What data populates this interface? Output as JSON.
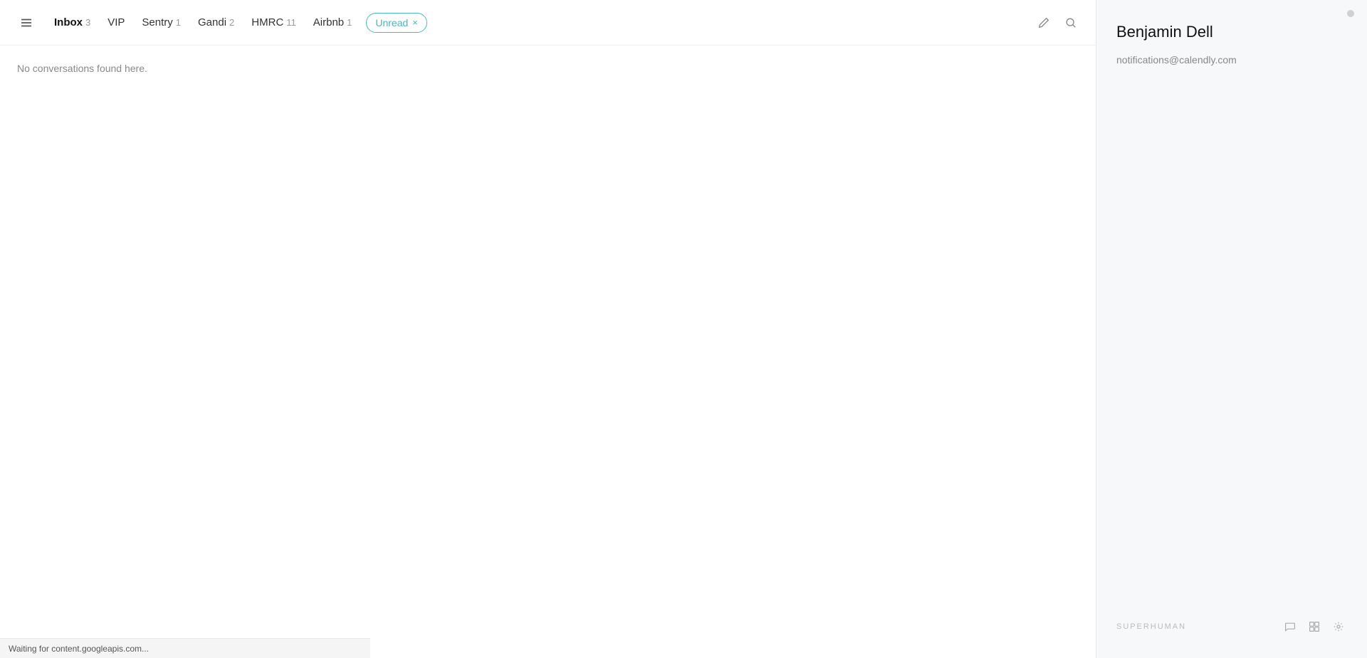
{
  "tabs": [
    {
      "id": "inbox",
      "label": "Inbox",
      "count": "3",
      "active": true
    },
    {
      "id": "vip",
      "label": "VIP",
      "count": null,
      "active": false
    },
    {
      "id": "sentry",
      "label": "Sentry",
      "count": "1",
      "active": false
    },
    {
      "id": "gandi",
      "label": "Gandi",
      "count": "2",
      "active": false
    },
    {
      "id": "hmrc",
      "label": "HMRC",
      "count": "11",
      "active": false
    },
    {
      "id": "airbnb",
      "label": "Airbnb",
      "count": "1",
      "active": false
    }
  ],
  "filter": {
    "label": "Unread",
    "close_label": "×"
  },
  "empty_state": {
    "text": "No conversations found here."
  },
  "contact": {
    "name": "Benjamin Dell",
    "email": "notifications@calendly.com"
  },
  "brand": {
    "logo": "SUPERHUMAN"
  },
  "status_bar": {
    "text": "Waiting for content.googleapis.com..."
  },
  "toolbar": {
    "compose_label": "Compose",
    "search_label": "Search"
  },
  "footer_icons": {
    "chat": "💬",
    "grid": "⊞",
    "settings": "⚙"
  }
}
